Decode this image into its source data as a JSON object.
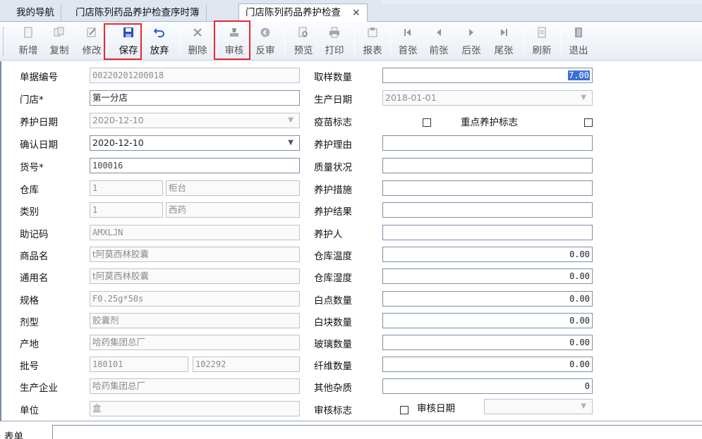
{
  "tabs": [
    {
      "label": "我的导航"
    },
    {
      "label": "门店陈列药品养护检查序时簿"
    },
    {
      "label": "门店陈列药品养护检查",
      "close": "×"
    }
  ],
  "toolbar": {
    "new": "新增",
    "copy": "复制",
    "edit": "修改",
    "save": "保存",
    "discard": "放弃",
    "delete": "删除",
    "audit": "审核",
    "unaudit": "反审",
    "preview": "预览",
    "print": "打印",
    "report": "报表",
    "first": "首张",
    "prev": "前张",
    "next": "后张",
    "last": "尾张",
    "refresh": "刷新",
    "exit": "退出"
  },
  "form": {
    "doc_no": {
      "label": "单据编号",
      "value": "00220201200018"
    },
    "store": {
      "label": "门店*",
      "value": "第一分店"
    },
    "care_date": {
      "label": "养护日期",
      "value": "2020-12-10"
    },
    "confirm_date": {
      "label": "确认日期",
      "value": "2020-12-10"
    },
    "item_no": {
      "label": "货号*",
      "value": "100016"
    },
    "warehouse": {
      "label": "仓库",
      "code": "1",
      "name": "柜台"
    },
    "category": {
      "label": "类别",
      "code": "1",
      "name": "西药"
    },
    "mnemonic": {
      "label": "助记码",
      "value": "AMXLJN"
    },
    "product_name": {
      "label": "商品名",
      "value": "t阿莫西林胶囊"
    },
    "generic_name": {
      "label": "通用名",
      "value": "t阿莫西林胶囊"
    },
    "spec": {
      "label": "规格",
      "value": "F0.25g*50s"
    },
    "dosage_form": {
      "label": "剂型",
      "value": "胶囊剂"
    },
    "origin": {
      "label": "产地",
      "value": "哈药集团总厂"
    },
    "batch_no": {
      "label": "批号",
      "value": "180101",
      "value2": "102292"
    },
    "manufacturer": {
      "label": "生产企业",
      "value": "哈药集团总厂"
    },
    "unit": {
      "label": "单位",
      "value": "盒"
    },
    "sample_qty": {
      "label": "取样数量",
      "value": "7.00"
    },
    "prod_date": {
      "label": "生产日期",
      "value": "2018-01-01"
    },
    "vaccine_flag": {
      "label": "疫苗标志"
    },
    "key_care_flag": {
      "label": "重点养护标志"
    },
    "care_reason": {
      "label": "养护理由",
      "value": ""
    },
    "quality": {
      "label": "质量状况",
      "value": ""
    },
    "measures": {
      "label": "养护措施",
      "value": ""
    },
    "result": {
      "label": "养护结果",
      "value": ""
    },
    "caretaker": {
      "label": "养护人",
      "value": ""
    },
    "temp": {
      "label": "仓库温度",
      "value": "0.00"
    },
    "humidity": {
      "label": "仓库湿度",
      "value": "0.00"
    },
    "white_dots": {
      "label": "白点数量",
      "value": "0.00"
    },
    "white_blocks": {
      "label": "白块数量",
      "value": "0.00"
    },
    "glass": {
      "label": "玻璃数量",
      "value": "0.00"
    },
    "fiber": {
      "label": "纤维数量",
      "value": "0.00"
    },
    "other_impurity": {
      "label": "其他杂质",
      "value": "0"
    },
    "audit_flag": {
      "label": "审核标志"
    },
    "audit_date": {
      "label": "审核日期",
      "value": ""
    }
  },
  "bottom": {
    "label": "表单"
  }
}
